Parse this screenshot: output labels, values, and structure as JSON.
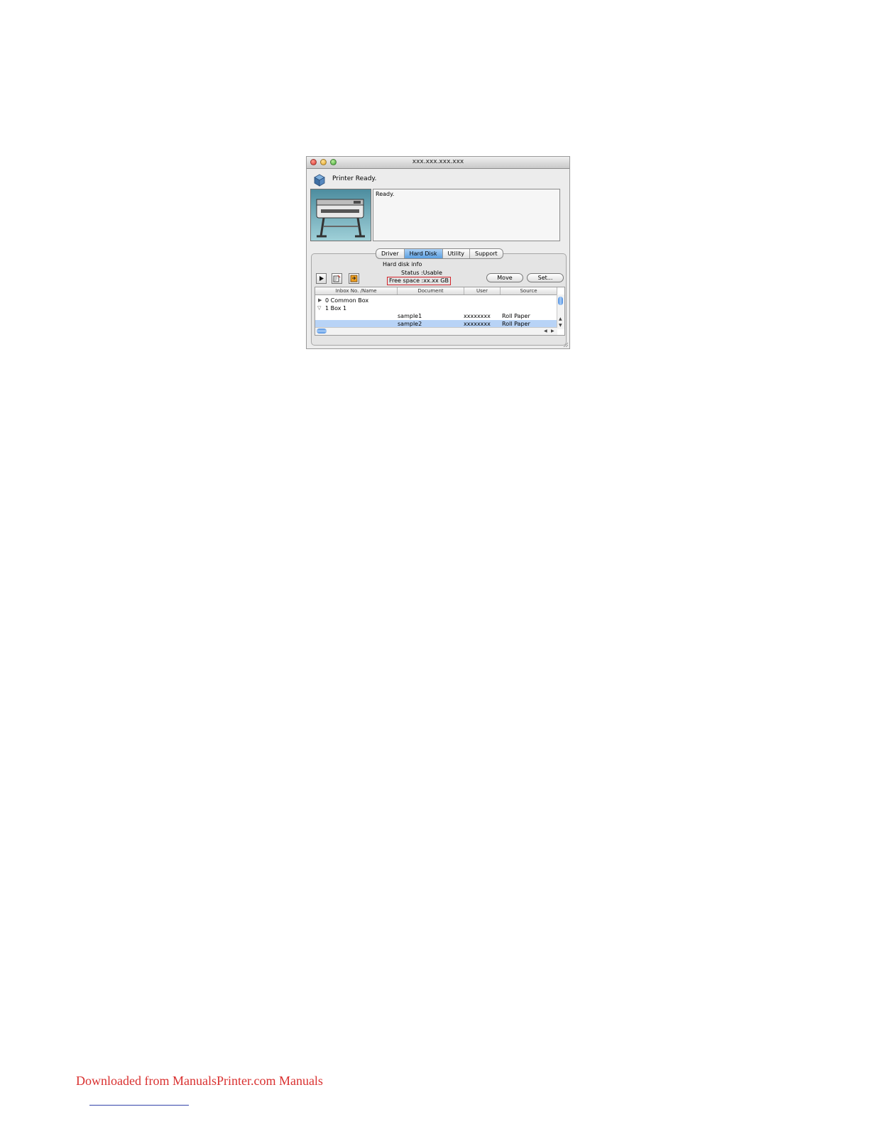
{
  "window": {
    "title": "xxx.xxx.xxx.xxx",
    "status_text": "Printer Ready.",
    "message": "Ready."
  },
  "tabs": [
    {
      "label": "Driver",
      "active": false
    },
    {
      "label": "Hard Disk",
      "active": true
    },
    {
      "label": "Utility",
      "active": false
    },
    {
      "label": "Support",
      "active": false
    }
  ],
  "hard_disk": {
    "info_label": "Hard disk info",
    "status": "Status :Usable",
    "free_space": "Free space :xx.xx GB"
  },
  "buttons": {
    "move": "Move",
    "set": "Set..."
  },
  "table": {
    "columns": [
      "Inbox No. /Name",
      "Document",
      "User",
      "Source"
    ],
    "rows": [
      {
        "name": "0 Common Box",
        "document": "",
        "user": "",
        "source": "",
        "disclosure": "▶"
      },
      {
        "name": "1 Box 1",
        "document": "",
        "user": "",
        "source": "",
        "disclosure": "▽"
      },
      {
        "name": "",
        "document": "sample1",
        "user": "xxxxxxxx",
        "source": "Roll Paper",
        "disclosure": ""
      },
      {
        "name": "",
        "document": "sample2",
        "user": "xxxxxxxx",
        "source": "Roll Paper",
        "disclosure": "",
        "selected": true
      }
    ]
  },
  "footer": {
    "link_text": "Downloaded from ManualsPrinter.com Manuals"
  },
  "colors": {
    "highlight_box": "#d2232a",
    "selection": "#b8d3f6",
    "active_tab": "#5b9fe0",
    "footer_link": "#d9302f"
  }
}
